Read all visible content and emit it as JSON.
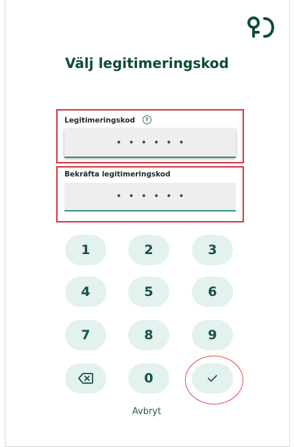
{
  "screen": {
    "title": "Välj legitimeringskod"
  },
  "fields": {
    "code_label": "Legitimeringskod",
    "code_value": "••••••",
    "confirm_label": "Bekräfta legitimeringskod",
    "confirm_value": "••••••",
    "help_icon": "question-circle-icon",
    "help_glyph": "?"
  },
  "keypad": {
    "keys": [
      "1",
      "2",
      "3",
      "4",
      "5",
      "6",
      "7",
      "8",
      "9",
      "0"
    ],
    "backspace_icon": "backspace-icon",
    "confirm_icon": "checkmark-icon"
  },
  "actions": {
    "cancel_label": "Avbryt"
  },
  "colors": {
    "brand": "#0f4a3f",
    "key_background": "#e3f1ef",
    "highlight": "#d0343f",
    "input_underline": "#2b9184"
  }
}
